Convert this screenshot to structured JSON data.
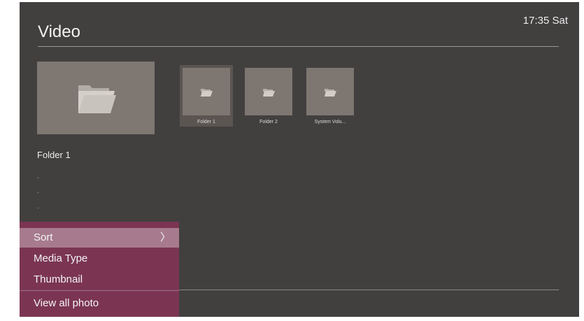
{
  "header": {
    "title": "Video",
    "clock": "17:35 Sat"
  },
  "preview": {
    "icon": "folder-icon"
  },
  "thumbnails": [
    {
      "label": "Folder 1",
      "icon": "folder-icon",
      "focused": true
    },
    {
      "label": "Folder 2",
      "icon": "folder-icon",
      "focused": false
    },
    {
      "label": "System Volu...",
      "icon": "folder-icon",
      "focused": false
    }
  ],
  "info": {
    "name": "Folder 1",
    "details": [
      "-",
      "-",
      "-"
    ]
  },
  "menu": {
    "items": [
      {
        "label": "Sort",
        "highlighted": true,
        "chevron": "〉"
      },
      {
        "label": "Media Type"
      },
      {
        "label": "Thumbnail"
      },
      {
        "label": "View all photo"
      }
    ]
  },
  "colors": {
    "background": "#423f3f",
    "menu_background": "#7b3553",
    "menu_highlight": "#a77b8d",
    "thumbnail": "#7d7671"
  }
}
